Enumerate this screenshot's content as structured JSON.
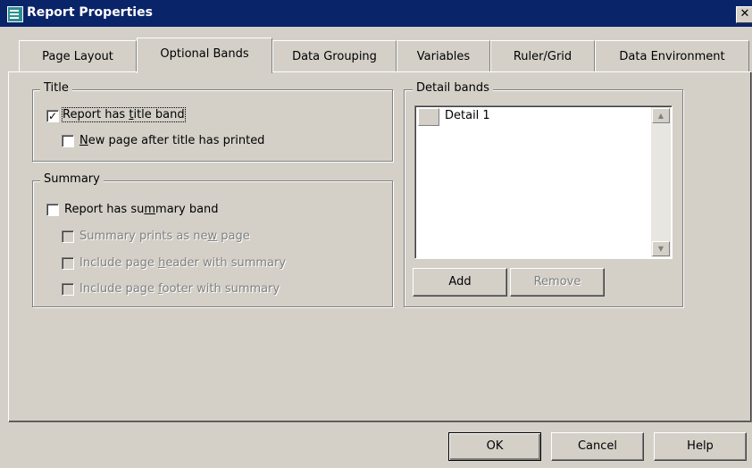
{
  "window": {
    "title": "Report Properties",
    "close_glyph": "✕"
  },
  "tabs": [
    {
      "label": "Page Layout",
      "selected": false
    },
    {
      "label": "Optional Bands",
      "selected": true
    },
    {
      "label": "Data Grouping",
      "selected": false
    },
    {
      "label": "Variables",
      "selected": false
    },
    {
      "label": "Ruler/Grid",
      "selected": false
    },
    {
      "label": "Data Environment",
      "selected": false
    }
  ],
  "title_group": {
    "legend": "Title",
    "report_has_title_band": {
      "pre": "Report has ",
      "mnemonic": "t",
      "post": "itle band",
      "checked": true
    },
    "new_page_after_title": {
      "pre": "",
      "mnemonic": "N",
      "post": "ew page after title has printed",
      "checked": false
    }
  },
  "summary_group": {
    "legend": "Summary",
    "report_has_summary_band": {
      "pre": "Report has su",
      "mnemonic": "m",
      "post": "mary band",
      "checked": false
    },
    "summary_prints_new_page": {
      "pre": "Summary prints as ne",
      "mnemonic": "w",
      "post": " page",
      "checked": false
    },
    "include_page_header": {
      "pre": "Include page ",
      "mnemonic": "h",
      "post": "eader with summary",
      "checked": false
    },
    "include_page_footer": {
      "pre": "Include page ",
      "mnemonic": "f",
      "post": "ooter with summary",
      "checked": false
    }
  },
  "detail_bands": {
    "legend": "Detail bands",
    "items": [
      "Detail 1"
    ],
    "add_label": "Add",
    "remove_label": "Remove"
  },
  "footer_buttons": {
    "ok": "OK",
    "cancel": "Cancel",
    "help": "Help"
  },
  "check_glyph": "✓"
}
